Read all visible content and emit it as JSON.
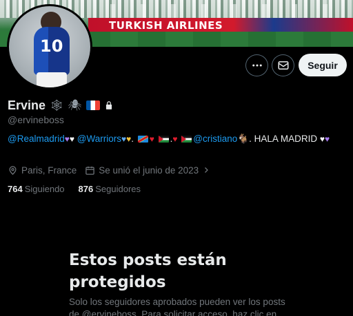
{
  "profile": {
    "name": "Ervine",
    "handle": "@ervineboss",
    "location": "Paris, France",
    "joined": "Se unió el junio de 2023",
    "banner_ad_text": "TURKISH AIRLINES",
    "jersey_text": "10",
    "bio": {
      "mention_1": "@Realmadrid",
      "mention_2": "@Warriors",
      "mention_3": "@cristiano",
      "tail": ". HALA MADRID"
    }
  },
  "actions": {
    "follow_label": "Seguir",
    "more_icon": "ellipsis-icon",
    "message_icon": "envelope-icon"
  },
  "stats": {
    "following_count": "764",
    "following_label": "Siguiendo",
    "followers_count": "876",
    "followers_label": "Seguidores"
  },
  "protected": {
    "title": "Estos posts están protegidos",
    "text": "Solo los seguidores aprobados pueden ver los posts de @ervineboss. Para solicitar acceso, haz clic en"
  },
  "colors": {
    "accent": "#1d9bf0",
    "muted": "#71767b",
    "text": "#e7e9ea",
    "background": "#000000"
  }
}
